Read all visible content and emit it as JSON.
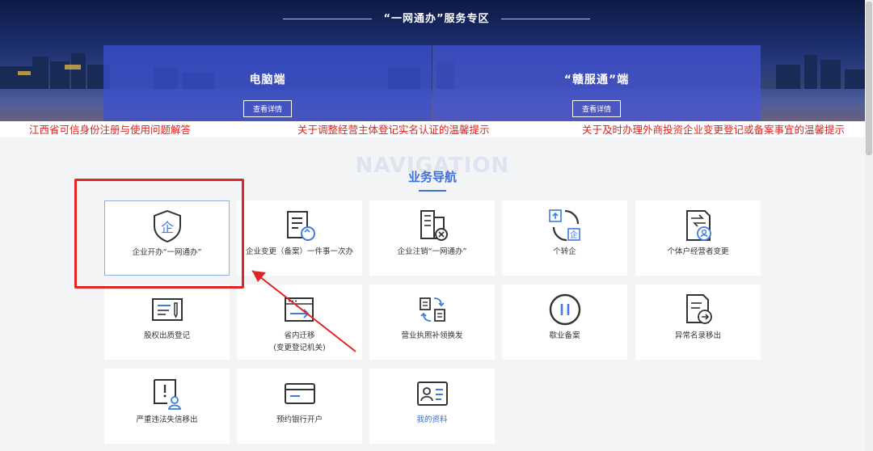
{
  "banner": {
    "title": "“一网通办”服务专区",
    "left_panel": {
      "title": "电脑端",
      "button": "查看详情"
    },
    "right_panel": {
      "title": "“赣服通”端",
      "button": "查看详情"
    }
  },
  "notices": [
    "江西省可信身份注册与使用问题解答",
    "关于调整经营主体登记实名认证的温馨提示",
    "关于及时办理外商投资企业变更登记或备案事宜的温馨提示"
  ],
  "navigation": {
    "bg_text": "NAVIGATION",
    "title": "业务导航",
    "cards": [
      {
        "label": "企业开办“一网通办”",
        "icon": "shield-enterprise-icon"
      },
      {
        "label": "企业变更（备案）一件事一次办",
        "icon": "document-refresh-icon"
      },
      {
        "label": "企业注销“一网通办”",
        "icon": "building-cancel-icon"
      },
      {
        "label": "个转企",
        "icon": "person-to-enterprise-icon"
      },
      {
        "label": "个体户经营者变更",
        "icon": "document-user-icon"
      },
      {
        "label": "股权出质登记",
        "icon": "form-pen-icon"
      },
      {
        "label": "省内迁移",
        "label2": "(变更登记机关)",
        "icon": "window-arrow-icon"
      },
      {
        "label": "营业执照补领换发",
        "icon": "license-exchange-icon"
      },
      {
        "label": "歇业备案",
        "icon": "pause-icon"
      },
      {
        "label": "异常名录移出",
        "icon": "document-arrow-icon"
      },
      {
        "label": "严重违法失信移出",
        "icon": "warning-user-icon"
      },
      {
        "label": "预约银行开户",
        "icon": "bank-card-icon"
      },
      {
        "label": "我的资料",
        "icon": "id-card-icon"
      }
    ]
  },
  "colors": {
    "accent": "#3f6fd8",
    "notice_red": "#e0201f",
    "highlight_red": "#e12424",
    "icon_dark": "#333333",
    "icon_blue": "#3f7be0"
  }
}
